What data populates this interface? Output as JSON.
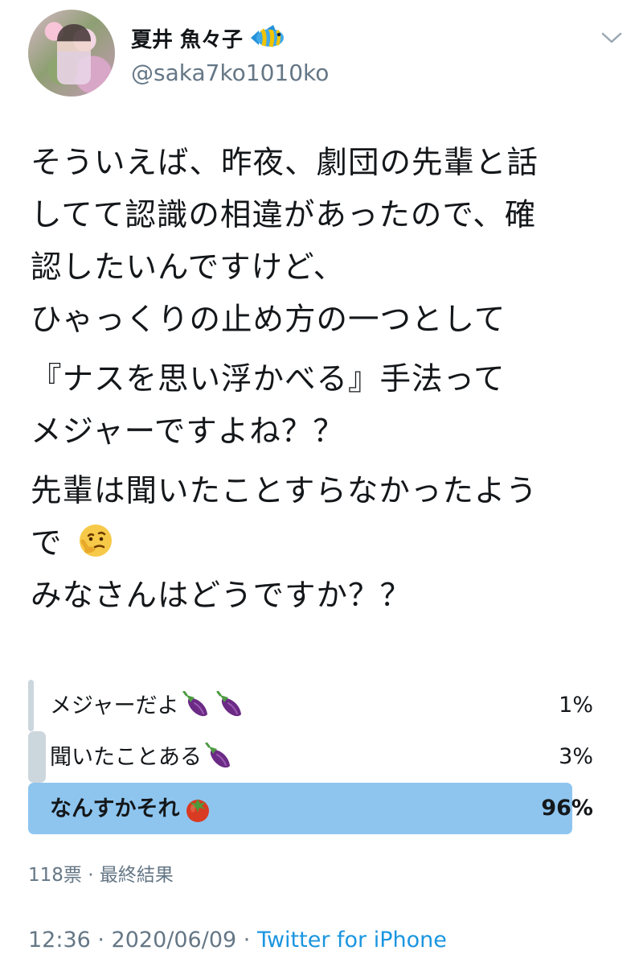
{
  "tweet": {
    "author": {
      "display_name": "夏井 魚々子",
      "handle": "@saka7ko1010ko",
      "name_icon": "tropical-fish-icon"
    },
    "text_lines": [
      "そういえば、昨夜、劇団の先輩と話",
      "してて認識の相違があったので、確",
      "認したいんですけど、",
      "ひゃっくりの止め方の一つとして",
      "『ナスを思い浮かべる』手法って",
      "メジャーですよね？？",
      "先輩は聞いたことすらなかったよう",
      "で",
      "みなさんはどうですか？？"
    ],
    "inline_icon": "thinking-face-icon"
  },
  "poll": {
    "options": [
      {
        "label": "メジャーだよ",
        "percent": "1%",
        "share": 1,
        "icons": [
          "eggplant-icon",
          "eggplant-icon"
        ]
      },
      {
        "label": "聞いたことある",
        "percent": "3%",
        "share": 3,
        "icons": [
          "eggplant-icon"
        ]
      },
      {
        "label": "なんすかそれ",
        "percent": "96%",
        "share": 96,
        "icons": [
          "tomato-icon"
        ]
      }
    ],
    "meta": "118票 · 最終結果"
  },
  "footer": {
    "timestamp": "12:36 · 2020/06/09 · ",
    "source": "Twitter for iPhone"
  },
  "colors": {
    "text": "#14171a",
    "secondary_text": "#657786",
    "twitter_blue": "#1b95e0",
    "poll_winner": "#8ec5ef",
    "poll_other": "#ccd6dd"
  }
}
